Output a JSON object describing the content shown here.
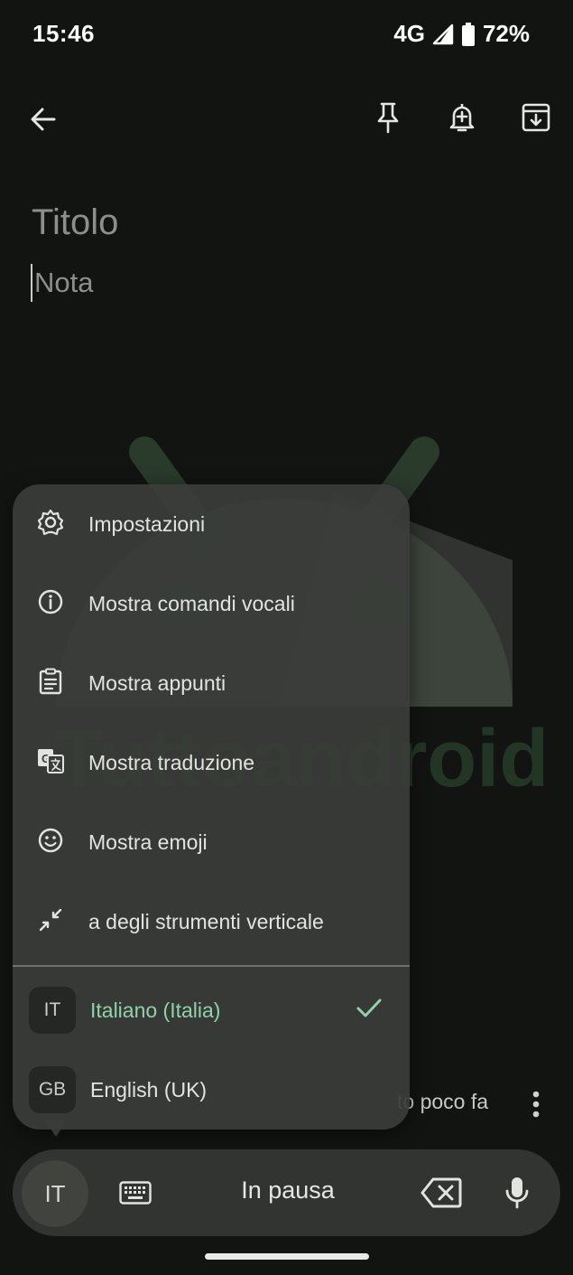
{
  "status_bar": {
    "time": "15:46",
    "network": "4G",
    "battery": "72%"
  },
  "top_bar": {
    "icons": [
      "back-arrow-icon",
      "pin-icon",
      "add-reminder-icon",
      "archive-icon"
    ]
  },
  "note": {
    "title_placeholder": "Titolo",
    "body_placeholder": "Nota"
  },
  "watermark": {
    "text": "Tuttoandroid"
  },
  "footer": {
    "edited_text": "to poco fa"
  },
  "menu": {
    "items": [
      {
        "label": "Impostazioni",
        "icon": "settings-gear-icon"
      },
      {
        "label": "Mostra comandi vocali",
        "icon": "info-icon"
      },
      {
        "label": "Mostra appunti",
        "icon": "clipboard-icon"
      },
      {
        "label": "Mostra traduzione",
        "icon": "translate-icon"
      },
      {
        "label": "Mostra emoji",
        "icon": "emoji-icon"
      },
      {
        "label": "a degli strumenti verticale",
        "icon": "collapse-arrows-icon"
      }
    ],
    "languages": [
      {
        "code": "IT",
        "label": "Italiano (Italia)",
        "selected": true
      },
      {
        "code": "GB",
        "label": "English (UK)",
        "selected": false
      }
    ]
  },
  "voice_toolbar": {
    "language_code": "IT",
    "status": "In pausa"
  },
  "colors": {
    "background": "#121412",
    "menu": "#3a3c39",
    "accent_green": "#8fd3a7"
  }
}
